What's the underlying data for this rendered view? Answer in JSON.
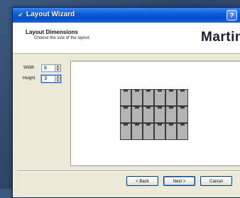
{
  "window": {
    "title": "Layout Wizard",
    "help_label": "?"
  },
  "header": {
    "title": "Layout Dimensions",
    "subtitle": "Choose the size of the layout.",
    "logo": "Martin"
  },
  "fields": {
    "width": {
      "label": "Width",
      "value": "6"
    },
    "height": {
      "label": "Height",
      "value": "3"
    }
  },
  "preview": {
    "columns": 6,
    "rows": 3,
    "tile_color": "#b4b4b4",
    "tile_border_color": "#3a3a3a"
  },
  "buttons": {
    "back": "< Back",
    "next": "Next >",
    "cancel": "Cancel"
  },
  "colors": {
    "desktop": "#2c4566",
    "titlebar": "#0a5ed8",
    "dialog_face": "#ece9d8"
  }
}
